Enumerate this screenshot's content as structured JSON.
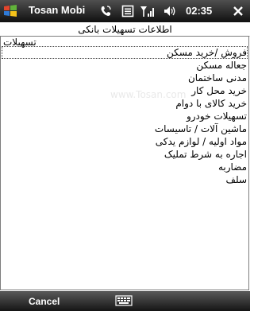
{
  "titlebar": {
    "app_title": "Tosan Mobi",
    "clock": "02:35",
    "icons": [
      "windows-start-icon",
      "phone-icon",
      "message-icon",
      "signal-icon",
      "volume-icon",
      "close-icon"
    ]
  },
  "page": {
    "title": "اطلاعات تسهیلات بانکی"
  },
  "list": {
    "header": "تسهیلات",
    "selected_index": 0,
    "items": [
      "فروش /خرید مسکن",
      "جعاله مسکن",
      "مدنی ساختمان",
      "خرید محل کار",
      "خرید کالای با دوام",
      "تسهیلات خودرو",
      "ماشین آلات / تاسیسات",
      "مواد اولیه / لوازم یدکی",
      "اجاره به شرط تملیک",
      "مضاربه",
      "سلف"
    ]
  },
  "watermark": "www.Tosan.com",
  "menubar": {
    "left_softkey": "Cancel",
    "center_icon": "keyboard-icon"
  },
  "colors": {
    "bar_dark": "#101010",
    "bar_light": "#4f4f4f",
    "background": "#ffffff"
  }
}
